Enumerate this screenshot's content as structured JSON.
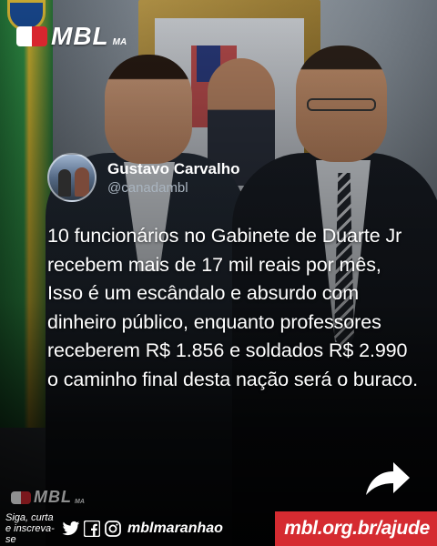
{
  "brand": {
    "logo_text": "MBL",
    "logo_sub": "MA",
    "colors": {
      "accent_red": "#d52b31",
      "text": "#ffffff",
      "handle_gray": "#a9b4bf"
    }
  },
  "tweet": {
    "author_name": "Gustavo Carvalho",
    "author_handle": "@canadambl",
    "text": "10 funcionários no Gabinete de Duarte Jr recebem mais de 17 mil reais por mês, Isso é um escândalo e absurdo com dinheiro público, enquanto professores receberem R$ 1.856 e soldados R$ 2.990 o caminho final desta nação será o buraco."
  },
  "footer": {
    "follow_text": "Siga, curta e inscreva-se",
    "social_icons": [
      "twitter-icon",
      "facebook-icon",
      "instagram-icon"
    ],
    "social_handle": "mblmaranhao",
    "help_link": "mbl.org.br/ajude"
  },
  "share_icon": "share-arrow-icon"
}
